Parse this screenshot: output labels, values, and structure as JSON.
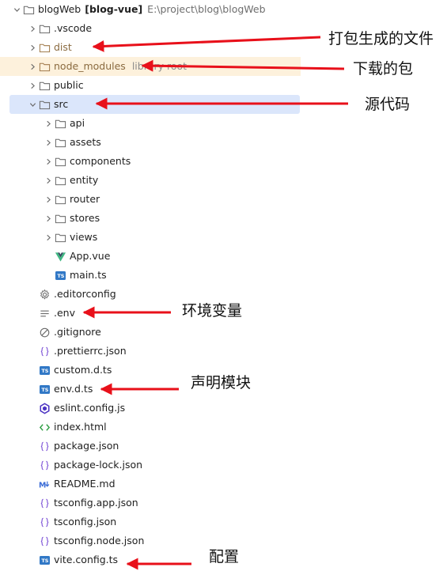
{
  "root": {
    "name": "blogWeb",
    "bold": "[blog-vue]",
    "path": "E:\\project\\blog\\blogWeb"
  },
  "items": [
    {
      "label": "blogWeb",
      "kind": "root"
    },
    {
      "label": ".vscode",
      "kind": "folder",
      "indent": 1
    },
    {
      "label": "dist",
      "kind": "folder",
      "indent": 1,
      "muted": true
    },
    {
      "label": "node_modules",
      "kind": "folder",
      "indent": 1,
      "muted": true,
      "hint": "library root"
    },
    {
      "label": "public",
      "kind": "folder",
      "indent": 1
    },
    {
      "label": "src",
      "kind": "folder",
      "indent": 1,
      "open": true,
      "selected": true
    },
    {
      "label": "api",
      "kind": "folder",
      "indent": 2
    },
    {
      "label": "assets",
      "kind": "folder",
      "indent": 2
    },
    {
      "label": "components",
      "kind": "folder",
      "indent": 2
    },
    {
      "label": "entity",
      "kind": "folder",
      "indent": 2
    },
    {
      "label": "router",
      "kind": "folder",
      "indent": 2
    },
    {
      "label": "stores",
      "kind": "folder",
      "indent": 2
    },
    {
      "label": "views",
      "kind": "folder",
      "indent": 2
    },
    {
      "label": "App.vue",
      "kind": "vue",
      "indent": 2
    },
    {
      "label": "main.ts",
      "kind": "ts",
      "indent": 2
    },
    {
      "label": ".editorconfig",
      "kind": "gear",
      "indent": 1
    },
    {
      "label": ".env",
      "kind": "lines",
      "indent": 1
    },
    {
      "label": ".gitignore",
      "kind": "ban",
      "indent": 1
    },
    {
      "label": ".prettierrc.json",
      "kind": "json",
      "indent": 1
    },
    {
      "label": "custom.d.ts",
      "kind": "ts",
      "indent": 1
    },
    {
      "label": "env.d.ts",
      "kind": "ts",
      "indent": 1
    },
    {
      "label": "eslint.config.js",
      "kind": "eslint",
      "indent": 1
    },
    {
      "label": "index.html",
      "kind": "html",
      "indent": 1
    },
    {
      "label": "package.json",
      "kind": "json",
      "indent": 1
    },
    {
      "label": "package-lock.json",
      "kind": "json",
      "indent": 1
    },
    {
      "label": "README.md",
      "kind": "md",
      "indent": 1
    },
    {
      "label": "tsconfig.app.json",
      "kind": "json",
      "indent": 1
    },
    {
      "label": "tsconfig.json",
      "kind": "json",
      "indent": 1
    },
    {
      "label": "tsconfig.node.json",
      "kind": "json",
      "indent": 1
    },
    {
      "label": "vite.config.ts",
      "kind": "ts",
      "indent": 1
    }
  ],
  "annotations": [
    {
      "text": "打包生成的文件",
      "target": 2
    },
    {
      "text": "下载的包",
      "target": 3
    },
    {
      "text": "源代码",
      "target": 5
    },
    {
      "text": "环境变量",
      "target": 16
    },
    {
      "text": "声明模块",
      "target": 20
    },
    {
      "text": "配置",
      "target": 29
    }
  ],
  "colors": {
    "arrow": "#e8101a",
    "selected": "#dbe6fb",
    "ignored": "#fdf1dc",
    "folder": "#6b6b6b",
    "ts": "#3178c6",
    "eslint": "#4b32c3",
    "vue": "#41b883"
  },
  "icons": {
    "ts": "typescript-icon",
    "vue": "vue-icon",
    "json": "json-braces-icon",
    "md": "markdown-icon",
    "html": "html-brackets-icon",
    "gear": "gear-icon",
    "ban": "ignore-icon",
    "lines": "env-lines-icon",
    "eslint": "eslint-icon"
  }
}
